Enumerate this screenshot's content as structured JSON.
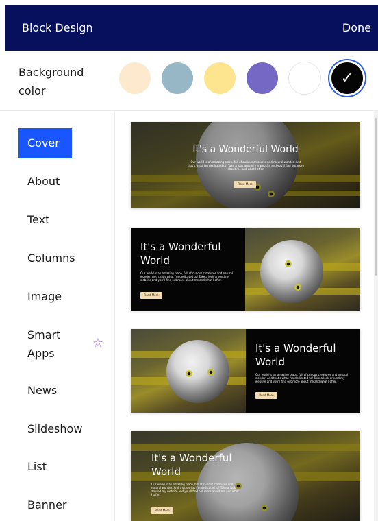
{
  "header": {
    "title": "Block Design",
    "done_label": "Done"
  },
  "background_color": {
    "label": "Background color",
    "swatches": [
      {
        "color": "#fde9cd",
        "selected": false
      },
      {
        "color": "#97b7c7",
        "selected": false
      },
      {
        "color": "#fde48f",
        "selected": false
      },
      {
        "color": "#7468c4",
        "selected": false
      },
      {
        "color": "#ffffff",
        "selected": false
      },
      {
        "color": "#050505",
        "selected": true
      }
    ],
    "check_icon": "checkmark-icon"
  },
  "sidebar": {
    "items": [
      {
        "label": "Cover",
        "active": true
      },
      {
        "label": "About",
        "active": false
      },
      {
        "label": "Text",
        "active": false
      },
      {
        "label": "Columns",
        "active": false
      },
      {
        "label": "Image",
        "active": false
      },
      {
        "label": "Smart Apps",
        "active": false,
        "badge_icon": "star-icon"
      },
      {
        "label": "News",
        "active": false
      },
      {
        "label": "Slideshow",
        "active": false
      },
      {
        "label": "List",
        "active": false
      },
      {
        "label": "Banner",
        "active": false
      }
    ]
  },
  "previews": {
    "heading": "It's a Wonderful World",
    "body": "Our world is an amazing place, full of curious creatures and natural wonder. And that's what I'm dedicated to! Take a look around my website and you'll find out more about me and what I offer.",
    "button_label": "Read More"
  },
  "colors": {
    "header_bg": "#07105c",
    "active_item": "#1a56ff",
    "selected_ring": "#3162e8",
    "star": "#b46be6"
  }
}
